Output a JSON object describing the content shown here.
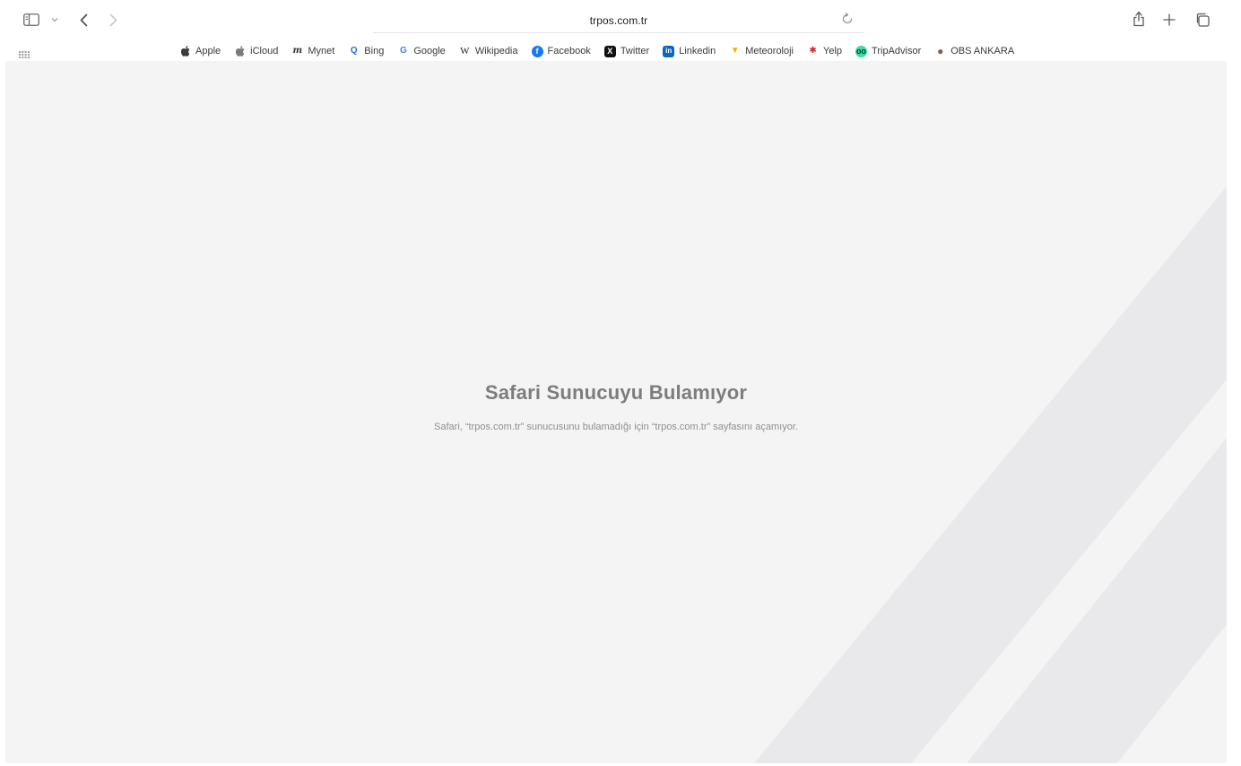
{
  "toolbar": {
    "sidebar_icon": "sidebar-icon",
    "sidebar_menu_icon": "chevron-down-icon",
    "back_icon": "chevron-left-icon",
    "forward_icon": "chevron-right-icon",
    "address": "trpos.com.tr",
    "reload_icon": "reload-icon",
    "share_icon": "share-icon",
    "new_tab_icon": "plus-icon",
    "tab_overview_icon": "tabs-icon"
  },
  "favorites": {
    "grid_icon": "grid-icon",
    "items": [
      {
        "label": "Apple",
        "icon": "apple-icon",
        "glyph": "",
        "color": "#3a3a3a"
      },
      {
        "label": "iCloud",
        "icon": "apple-icon",
        "glyph": "",
        "color": "#7a7a7a"
      },
      {
        "label": "Mynet",
        "icon": "mynet-icon",
        "glyph": "m",
        "color": "#333333"
      },
      {
        "label": "Bing",
        "icon": "search-icon",
        "glyph": "Q",
        "color": "#1f6fd6"
      },
      {
        "label": "Google",
        "icon": "google-icon",
        "glyph": "G",
        "color": "#4285f4"
      },
      {
        "label": "Wikipedia",
        "icon": "wikipedia-icon",
        "glyph": "W",
        "color": "#222222"
      },
      {
        "label": "Facebook",
        "icon": "facebook-icon",
        "glyph": "f",
        "color": "#1877f2"
      },
      {
        "label": "Twitter",
        "icon": "x-icon",
        "glyph": "X",
        "color": "#111111"
      },
      {
        "label": "Linkedin",
        "icon": "linkedin-icon",
        "glyph": "in",
        "color": "#0a66c2"
      },
      {
        "label": "Meteoroloji",
        "icon": "meteoroloji-icon",
        "glyph": "▼",
        "color": "#e8b400"
      },
      {
        "label": "Yelp",
        "icon": "yelp-icon",
        "glyph": "✱",
        "color": "#d32323"
      },
      {
        "label": "TripAdvisor",
        "icon": "tripadvisor-icon",
        "glyph": "oo",
        "color": "#34e0a1"
      },
      {
        "label": "OBS ANKARA",
        "icon": "obs-ankara-icon",
        "glyph": "●",
        "color": "#8b5a5a"
      }
    ]
  },
  "error": {
    "title": "Safari Sunucuyu Bulamıyor",
    "message": "Safari, “trpos.com.tr” sunucusunu bulamadığı için “trpos.com.tr” sayfasını açamıyor."
  },
  "colors": {
    "content_bg": "#f4f4f5",
    "stripe": "#e9e9eb"
  }
}
